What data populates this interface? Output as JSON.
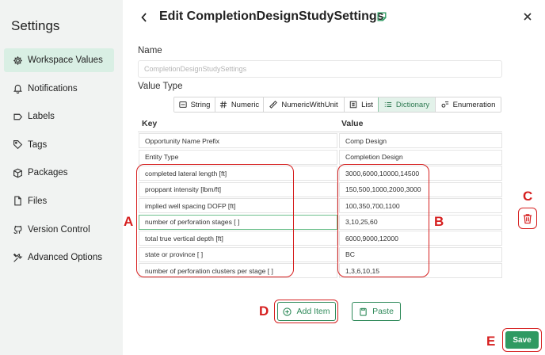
{
  "sidebar": {
    "title": "Settings",
    "items": [
      {
        "label": "Workspace Values",
        "icon": "gear-icon",
        "active": true
      },
      {
        "label": "Notifications",
        "icon": "bell-icon"
      },
      {
        "label": "Labels",
        "icon": "label-icon"
      },
      {
        "label": "Tags",
        "icon": "tag-icon"
      },
      {
        "label": "Packages",
        "icon": "package-icon"
      },
      {
        "label": "Files",
        "icon": "file-icon"
      },
      {
        "label": "Version Control",
        "icon": "version-control-icon"
      },
      {
        "label": "Advanced Options",
        "icon": "tools-icon"
      }
    ]
  },
  "header": {
    "title": "Edit CompletionDesignStudySettings"
  },
  "form": {
    "name_label": "Name",
    "name_placeholder": "CompletionDesignStudySettings",
    "value_type_label": "Value Type",
    "value_types": [
      {
        "label": "String",
        "icon": "string-icon"
      },
      {
        "label": "Numeric",
        "icon": "hash-icon"
      },
      {
        "label": "NumericWithUnit",
        "icon": "ruler-icon"
      },
      {
        "label": "List",
        "icon": "list-icon"
      },
      {
        "label": "Dictionary",
        "icon": "dictionary-icon",
        "active": true
      },
      {
        "label": "Enumeration",
        "icon": "enumeration-icon"
      }
    ]
  },
  "table": {
    "headers": {
      "key": "Key",
      "value": "Value"
    },
    "rows": [
      {
        "key": "Opportunity Name Prefix",
        "value": "Comp Design"
      },
      {
        "key": "Entity Type",
        "value": "Completion Design"
      },
      {
        "key": "completed lateral length [ft]",
        "value": "3000,6000,10000,14500"
      },
      {
        "key": "proppant intensity [lbm/ft]",
        "value": "150,500,1000,2000,3000"
      },
      {
        "key": "implied well spacing DOFP [ft]",
        "value": "100,350,700,1100"
      },
      {
        "key": "number of perforation stages [ ]",
        "value": "3,10,25,60"
      },
      {
        "key": "total true vertical depth [ft]",
        "value": "6000,9000,12000"
      },
      {
        "key": "state or province [ ]",
        "value": "BC"
      },
      {
        "key": "number of perforation clusters per stage [ ]",
        "value": "1,3,6,10,15"
      }
    ]
  },
  "annotations": {
    "a": "A",
    "b": "B",
    "c": "C",
    "d": "D",
    "e": "E"
  },
  "actions": {
    "add_item": "Add Item",
    "paste": "Paste",
    "save": "Save"
  },
  "colors": {
    "accent": "#2f9a62",
    "annotation": "#d61f1f",
    "sidebar_bg": "#f1f3f2",
    "active_bg": "#d9efe4"
  }
}
